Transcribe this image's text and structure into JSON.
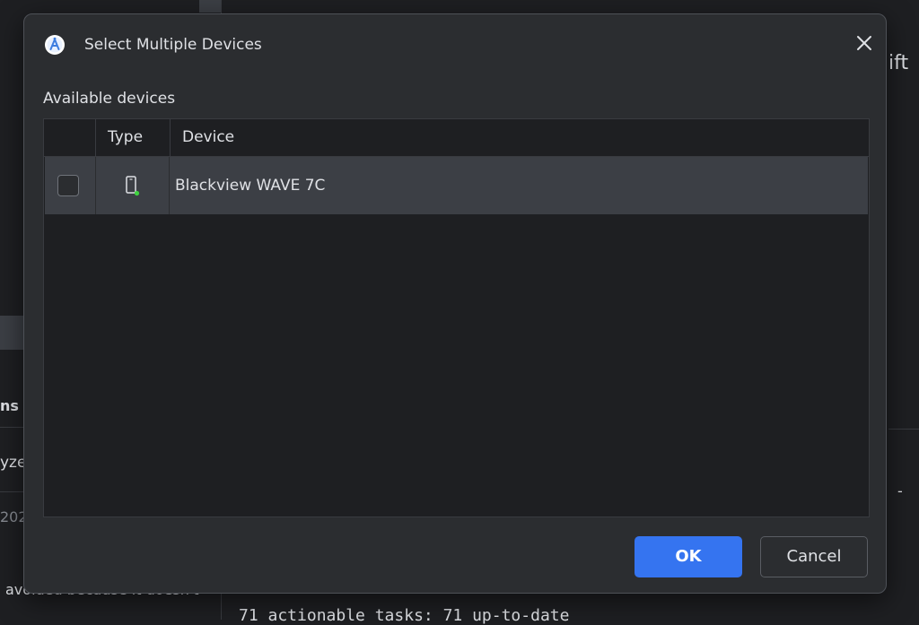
{
  "background": {
    "left_fragments": [
      "ns",
      "yze",
      "202",
      "avoided because it doesn't"
    ],
    "right_fragment": "ift",
    "right_dash": "-",
    "console_line": "71 actionable tasks: 71 up-to-date"
  },
  "dialog": {
    "title": "Select Multiple Devices",
    "app_icon": "android-studio-icon",
    "close_icon": "close-icon",
    "section_label": "Available devices",
    "table": {
      "columns": [
        "",
        "Type",
        "Device"
      ],
      "rows": [
        {
          "checked": false,
          "type_icon": "phone-icon",
          "status_color": "#3fd23f",
          "device": "Blackview WAVE 7C"
        }
      ]
    },
    "buttons": {
      "ok": "OK",
      "cancel": "Cancel"
    }
  },
  "colors": {
    "accent": "#3574f0",
    "dialog_bg": "#2b2d30",
    "table_bg": "#1e1f22",
    "selected_row": "#3c3f45"
  }
}
